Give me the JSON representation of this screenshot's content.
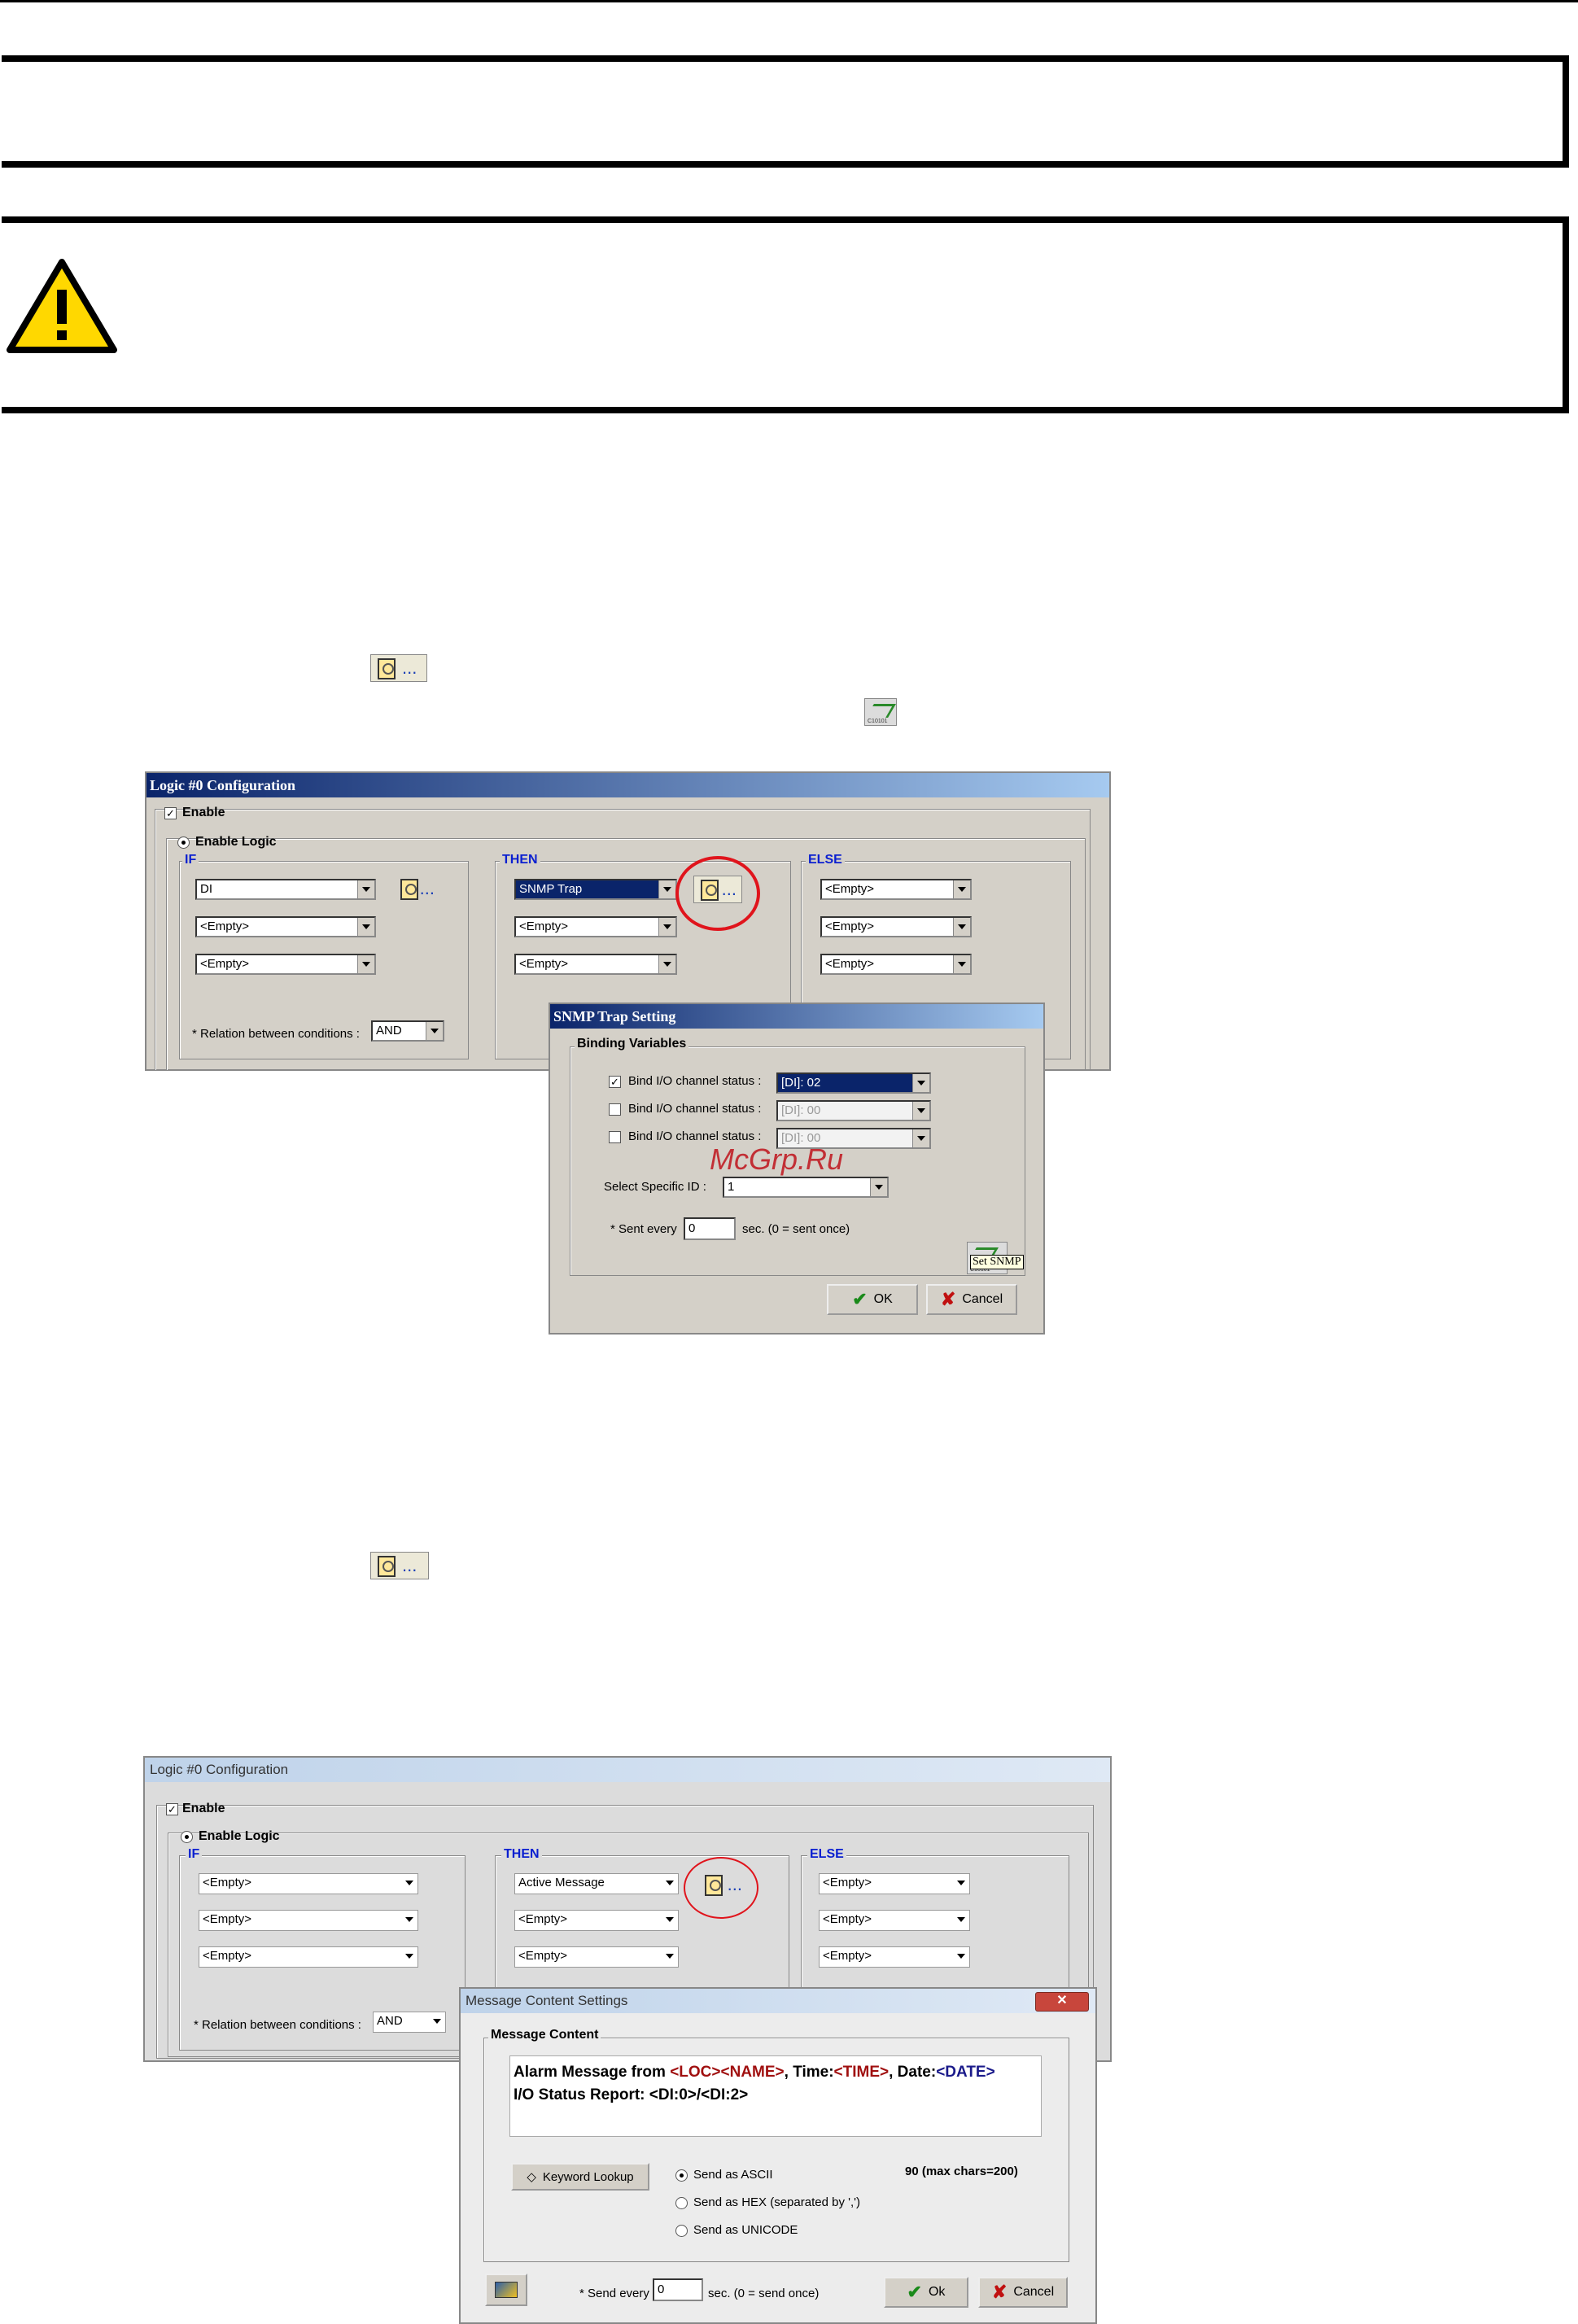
{
  "fig1": {
    "title": "Logic #0 Configuration",
    "enable": "Enable",
    "enable_logic": "Enable Logic",
    "if_label": "IF",
    "then_label": "THEN",
    "else_label": "ELSE",
    "if_sel": [
      "DI",
      "<Empty>",
      "<Empty>"
    ],
    "then_sel": [
      "SNMP Trap",
      "<Empty>",
      "<Empty>"
    ],
    "else_sel": [
      "<Empty>",
      "<Empty>",
      "<Empty>"
    ],
    "relation_label": "* Relation between conditions :",
    "relation_value": "AND",
    "icon_dots": "..."
  },
  "snmp": {
    "title": "SNMP Trap Setting",
    "group": "Binding Variables",
    "rows": [
      {
        "label": "Bind I/O channel status :",
        "value": "[DI]: 02",
        "checked": "✓"
      },
      {
        "label": "Bind I/O channel status :",
        "value": "[DI]: 00",
        "checked": ""
      },
      {
        "label": "Bind I/O channel status :",
        "value": "[DI]: 00",
        "checked": ""
      }
    ],
    "specific_label": "Select Specific ID :",
    "specific_value": "1",
    "sent_label": "* Sent every",
    "sent_value": "0",
    "sent_suffix": "sec. (0 = sent once)",
    "set_snmp": "Set SNMP",
    "ok": "OK",
    "cancel": "Cancel"
  },
  "watermark": "McGrp.Ru",
  "fig2": {
    "title": "Logic #0 Configuration",
    "enable": "Enable",
    "enable_logic": "Enable Logic",
    "if_label": "IF",
    "then_label": "THEN",
    "else_label": "ELSE",
    "if_sel": [
      "<Empty>",
      "<Empty>",
      "<Empty>"
    ],
    "then_sel": [
      "Active Message",
      "<Empty>",
      "<Empty>"
    ],
    "else_sel": [
      "<Empty>",
      "<Empty>",
      "<Empty>"
    ],
    "relation_label": "* Relation between conditions :",
    "relation_value": "AND",
    "icon_dots": "..."
  },
  "msgdlg": {
    "title": "Message Content Settings",
    "group": "Message Content",
    "line1_a": "Alarm Message from ",
    "line1_loc": "<LOC>",
    "line1_name": "<NAME>",
    "line1_b": ", Time:",
    "line1_time": "<TIME>",
    "line1_c": ", Date:",
    "line1_date": "<DATE>",
    "line2": "I/O Status Report: <DI:0>/<DI:2>",
    "keyword": "Keyword Lookup",
    "opt_ascii": "Send as ASCII",
    "opt_hex": "Send as HEX (separated by ',')",
    "opt_unicode": "Send as UNICODE",
    "count": "90 (max chars=200)",
    "send_every": "* Send every",
    "send_value": "0",
    "send_suffix": "sec. (0 = send once)",
    "ok": "Ok",
    "cancel": "Cancel"
  },
  "inline_icon_dots": "..."
}
